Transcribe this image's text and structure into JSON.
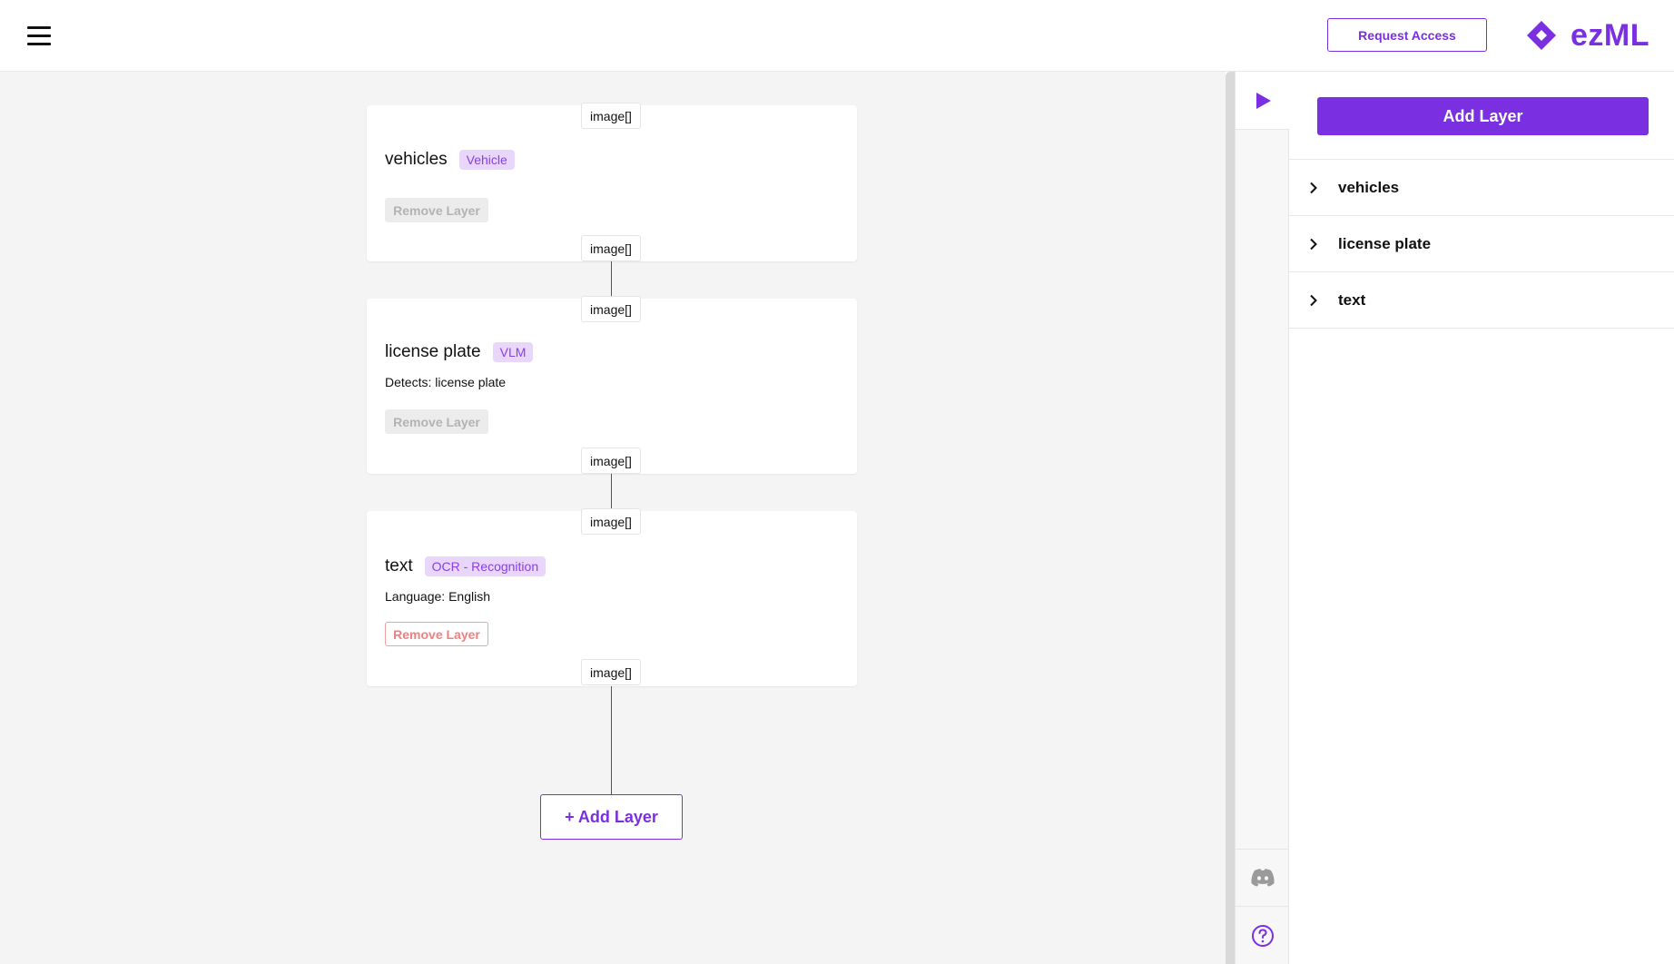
{
  "header": {
    "request_access": "Request Access",
    "logo_text": "ezML",
    "menu_icon": "hamburger-menu-icon",
    "logo_icon": "diamond-logo-icon"
  },
  "colors": {
    "accent": "#7a2fe0",
    "badge_bg": "#e8d6fb",
    "canvas_bg": "#f4f4f4",
    "remove_active": "#f08080"
  },
  "canvas": {
    "layers": [
      {
        "name": "vehicles",
        "badge": "Vehicle",
        "detail": "",
        "input_port": "image[]",
        "output_port": "image[]",
        "remove_label": "Remove Layer",
        "remove_enabled": false
      },
      {
        "name": "license plate",
        "badge": "VLM",
        "detail": "Detects: license plate",
        "input_port": "image[]",
        "output_port": "image[]",
        "remove_label": "Remove Layer",
        "remove_enabled": false
      },
      {
        "name": "text",
        "badge": "OCR - Recognition",
        "detail": "Language: English",
        "input_port": "image[]",
        "output_port": "image[]",
        "remove_label": "Remove Layer",
        "remove_enabled": true
      }
    ],
    "add_layer": "+ Add Layer"
  },
  "toolbar": {
    "icons": [
      "play-icon",
      "discord-icon",
      "help-icon"
    ]
  },
  "panel": {
    "add_layer": "Add Layer",
    "items": [
      {
        "label": "vehicles"
      },
      {
        "label": "license plate"
      },
      {
        "label": "text"
      }
    ]
  }
}
